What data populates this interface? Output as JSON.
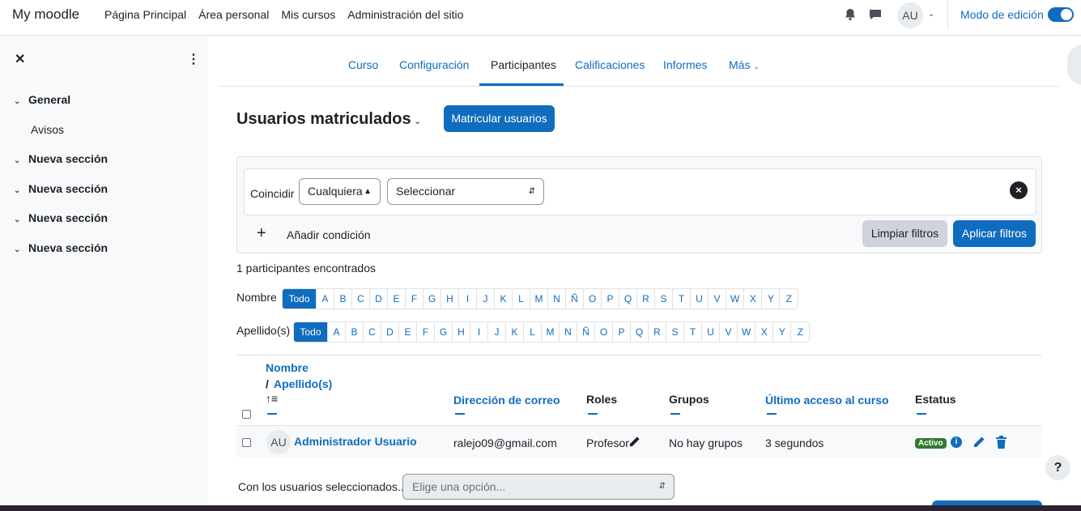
{
  "navbar": {
    "brand": "My moodle",
    "links": [
      "Página Principal",
      "Área personal",
      "Mis cursos",
      "Administración del sitio"
    ],
    "avatar": "AU",
    "edit_mode_label": "Modo de edición"
  },
  "drawer": {
    "sections": [
      {
        "label": "General",
        "items": [
          "Avisos"
        ]
      },
      {
        "label": "Nueva sección",
        "items": []
      },
      {
        "label": "Nueva sección",
        "items": []
      },
      {
        "label": "Nueva sección",
        "items": []
      },
      {
        "label": "Nueva sección",
        "items": []
      }
    ]
  },
  "tabs": [
    "Curso",
    "Configuración",
    "Participantes",
    "Calificaciones",
    "Informes",
    "Más"
  ],
  "active_tab": "Participantes",
  "page": {
    "title": "Usuarios matriculados",
    "enrol_button": "Matricular usuarios"
  },
  "filters": {
    "match_label": "Coincidir",
    "match_value": "Cualquiera",
    "type_value": "Seleccionar",
    "add_condition": "Añadir condición",
    "clear": "Limpiar filtros",
    "apply": "Aplicar filtros"
  },
  "count_text": "1 participantes encontrados",
  "initials": {
    "firstname_label": "Nombre",
    "lastname_label": "Apellido(s)",
    "all_label": "Todo",
    "letters": [
      "A",
      "B",
      "C",
      "D",
      "E",
      "F",
      "G",
      "H",
      "I",
      "J",
      "K",
      "L",
      "M",
      "N",
      "Ñ",
      "O",
      "P",
      "Q",
      "R",
      "S",
      "T",
      "U",
      "V",
      "W",
      "X",
      "Y",
      "Z"
    ]
  },
  "table": {
    "headers": {
      "name": "Nombre",
      "sep": "/",
      "lastname": "Apellido(s)",
      "email": "Dirección de correo",
      "roles": "Roles",
      "groups": "Grupos",
      "lastaccess": "Último acceso al curso",
      "status": "Estatus"
    },
    "rows": [
      {
        "initials": "AU",
        "name": "Administrador Usuario",
        "email": "ralejo09@gmail.com",
        "role": "Profesor",
        "groups": "No hay grupos",
        "lastaccess": "3 segundos",
        "status": "Activo"
      }
    ]
  },
  "bulk": {
    "label": "Con los usuarios seleccionados...",
    "placeholder": "Elige una opción..."
  },
  "help_label": "?",
  "colors": {
    "primary": "#0f6cbf",
    "success": "#357a32"
  }
}
